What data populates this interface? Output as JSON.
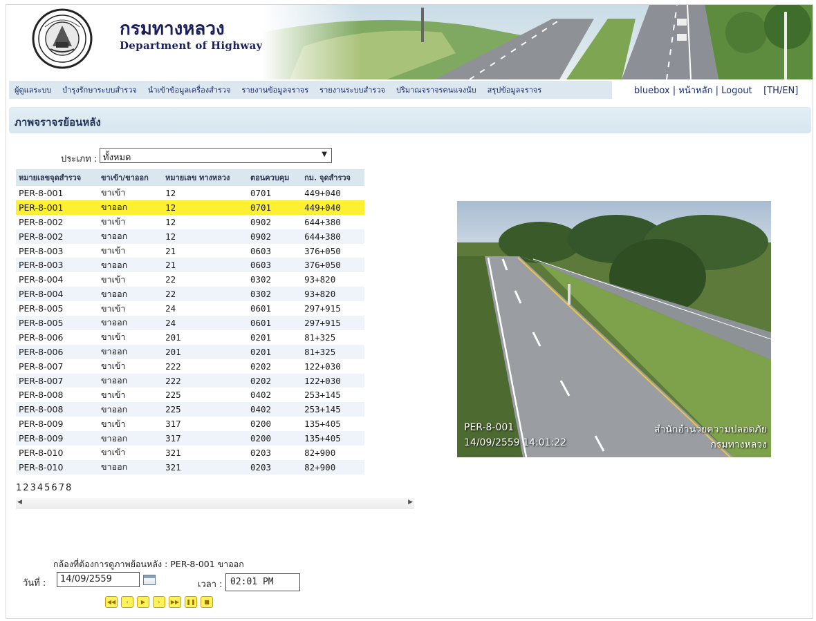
{
  "header": {
    "title_th": "กรมทางหลวง",
    "title_en": "Department of Highways",
    "logo_icon": "department-seal-icon"
  },
  "menu": {
    "items": [
      "ผู้ดูแลระบบ",
      "บำรุงรักษาระบบสำรวจ",
      "นำเข้าข้อมูลเครื่องสำรวจ",
      "รายงานข้อมูลจราจร",
      "รายงานระบบสำรวจ",
      "ปริมาณจราจรคนแจงนับ",
      "สรุปข้อมูลจราจร"
    ],
    "user": "bluebox",
    "home": "หน้าหลัก",
    "logout": "Logout",
    "lang": "[TH/EN]",
    "sep": "|"
  },
  "section": {
    "title": "ภาพจราจรย้อนหลัง"
  },
  "filter": {
    "label": "ประเภท :",
    "selected": "ทั้งหมด"
  },
  "table": {
    "headers": [
      "หมายเลขจุดสำรวจ",
      "ขาเข้า/ขาออก",
      "หมายเลข ทางหลวง",
      "ตอนควบคุม",
      "กม. จุดสำรวจ"
    ],
    "selected_row": 1,
    "rows": [
      [
        "PER-8-001",
        "ขาเข้า",
        "12",
        "0701",
        "449+040"
      ],
      [
        "PER-8-001",
        "ขาออก",
        "12",
        "0701",
        "449+040"
      ],
      [
        "PER-8-002",
        "ขาเข้า",
        "12",
        "0902",
        "644+380"
      ],
      [
        "PER-8-002",
        "ขาออก",
        "12",
        "0902",
        "644+380"
      ],
      [
        "PER-8-003",
        "ขาเข้า",
        "21",
        "0603",
        "376+050"
      ],
      [
        "PER-8-003",
        "ขาออก",
        "21",
        "0603",
        "376+050"
      ],
      [
        "PER-8-004",
        "ขาเข้า",
        "22",
        "0302",
        "93+820"
      ],
      [
        "PER-8-004",
        "ขาออก",
        "22",
        "0302",
        "93+820"
      ],
      [
        "PER-8-005",
        "ขาเข้า",
        "24",
        "0601",
        "297+915"
      ],
      [
        "PER-8-005",
        "ขาออก",
        "24",
        "0601",
        "297+915"
      ],
      [
        "PER-8-006",
        "ขาเข้า",
        "201",
        "0201",
        "81+325"
      ],
      [
        "PER-8-006",
        "ขาออก",
        "201",
        "0201",
        "81+325"
      ],
      [
        "PER-8-007",
        "ขาเข้า",
        "222",
        "0202",
        "122+030"
      ],
      [
        "PER-8-007",
        "ขาออก",
        "222",
        "0202",
        "122+030"
      ],
      [
        "PER-8-008",
        "ขาเข้า",
        "225",
        "0402",
        "253+145"
      ],
      [
        "PER-8-008",
        "ขาออก",
        "225",
        "0402",
        "253+145"
      ],
      [
        "PER-8-009",
        "ขาเข้า",
        "317",
        "0200",
        "135+405"
      ],
      [
        "PER-8-009",
        "ขาออก",
        "317",
        "0200",
        "135+405"
      ],
      [
        "PER-8-010",
        "ขาเข้า",
        "321",
        "0203",
        "82+900"
      ],
      [
        "PER-8-010",
        "ขาออก",
        "321",
        "0203",
        "82+900"
      ]
    ],
    "pages": [
      "1",
      "2",
      "3",
      "4",
      "5",
      "6",
      "7",
      "8"
    ]
  },
  "camera": {
    "station": "PER-8-001",
    "timestamp": "14/09/2559 14:01:22",
    "org_line1": "สำนักอำนวยความปลอดภัย",
    "org_line2": "กรมทางหลวง"
  },
  "playback": {
    "caption": "กล้องที่ต้องการดูภาพย้อนหลัง : PER-8-001 ขาออก",
    "date_label": "วันที่ :",
    "date_value": "14/09/2559",
    "time_label": "เวลา :",
    "time_value": "02:01 PM",
    "controls": [
      {
        "name": "rewind-fast-icon",
        "glyph": "◀◀"
      },
      {
        "name": "step-back-icon",
        "glyph": "‹"
      },
      {
        "name": "play-icon",
        "glyph": "▶"
      },
      {
        "name": "step-forward-icon",
        "glyph": "›"
      },
      {
        "name": "fast-forward-icon",
        "glyph": "▶▶"
      },
      {
        "name": "pause-icon",
        "glyph": "❚❚"
      },
      {
        "name": "stop-icon",
        "glyph": "■"
      }
    ]
  },
  "colors": {
    "menu_bg": "#dde7ef",
    "selected_row": "#fdf033",
    "title": "#1b1f5e",
    "control_button": "#fff25a"
  }
}
